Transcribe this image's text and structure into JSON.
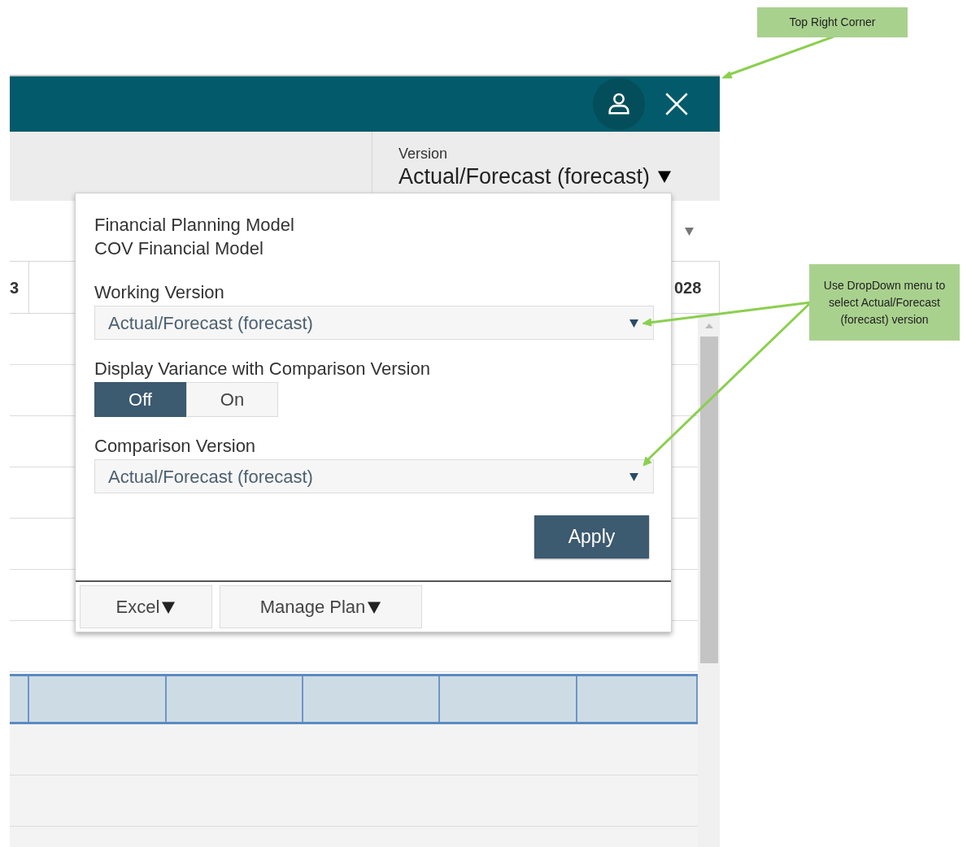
{
  "version": {
    "label": "Version",
    "value": "Actual/Forecast (forecast)"
  },
  "table": {
    "header_cells": [
      "3",
      "028"
    ]
  },
  "popup": {
    "model_lines": [
      "Financial Planning Model",
      "COV Financial Model"
    ],
    "working_version": {
      "label": "Working Version",
      "value": "Actual/Forecast (forecast)"
    },
    "variance": {
      "label": "Display Variance with Comparison Version",
      "options": [
        {
          "label": "Off",
          "selected": true
        },
        {
          "label": "On",
          "selected": false
        }
      ]
    },
    "comparison_version": {
      "label": "Comparison Version",
      "value": "Actual/Forecast (forecast)"
    },
    "apply": "Apply",
    "footer_buttons": [
      "Excel",
      "Manage Plan"
    ]
  },
  "annotations": [
    {
      "text": "Top Right Corner"
    },
    {
      "text": "Use DropDown menu to select Actual/Forecast (forecast) version"
    }
  ]
}
